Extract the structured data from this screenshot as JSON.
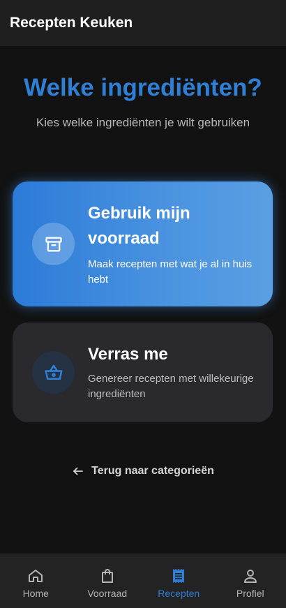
{
  "app_bar": {
    "title": "Recepten Keuken"
  },
  "header": {
    "title": "Welke ingrediënten?",
    "subtitle": "Kies welke ingrediënten je wilt gebruiken"
  },
  "options": [
    {
      "title_line1": "Gebruik mijn",
      "title_line2": "voorraad",
      "description": "Maak recepten met wat je al in huis hebt",
      "icon": "archive-box-icon"
    },
    {
      "title": "Verras me",
      "description": "Genereer recepten met willekeurige ingrediënten",
      "icon": "basket-icon"
    }
  ],
  "back_link": {
    "label": "Terug naar categorieën",
    "icon": "arrow-left-icon"
  },
  "bottom_nav": {
    "active": "Recepten",
    "accent_color": "#2f7fd6",
    "items": [
      {
        "label": "Home",
        "icon": "home-icon"
      },
      {
        "label": "Voorraad",
        "icon": "shopping-bag-icon"
      },
      {
        "label": "Recepten",
        "icon": "receipt-icon"
      },
      {
        "label": "Profiel",
        "icon": "person-icon"
      }
    ]
  }
}
